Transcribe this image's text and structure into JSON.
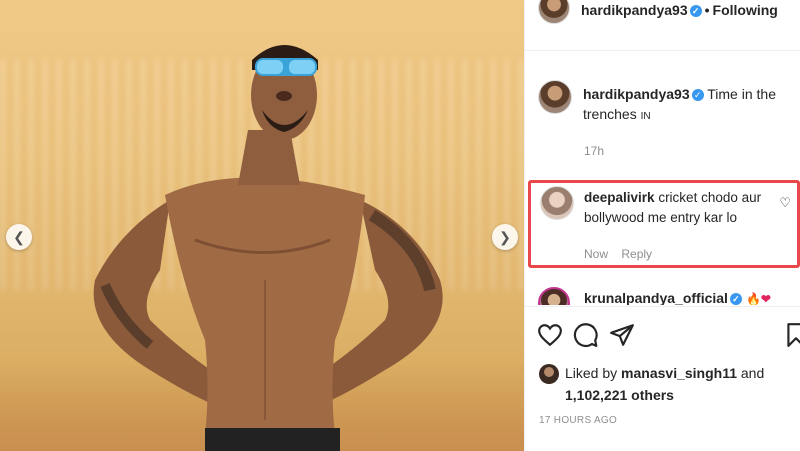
{
  "post": {
    "username": "hardikpandya93",
    "follow_status": "Following",
    "caption": {
      "username": "hardikpandya93",
      "text": "Time in the trenches",
      "flag_emoji": "IN",
      "time": "17h"
    },
    "highlighted_comment": {
      "username": "deepalivirk",
      "text": "cricket chodo aur bollywood me entry kar lo",
      "time": "Now",
      "reply_label": "Reply"
    },
    "next_comment": {
      "username": "krunalpandya_official",
      "emojis": "🔥❤"
    },
    "likes": {
      "prefix": "Liked by",
      "liker": "manasvi_singh11",
      "and_label": "and",
      "others": "1,102,221 others"
    },
    "posted": "17 HOURS AGO"
  },
  "colors": {
    "highlight_border": "#e8474b",
    "verified_badge": "#3897f0",
    "muted_text": "#8e8e8e"
  },
  "icons": {
    "prev": "chevron-left-icon",
    "next": "chevron-right-icon",
    "like": "heart-icon",
    "comment": "comment-icon",
    "share": "paper-plane-icon",
    "save": "bookmark-icon"
  }
}
